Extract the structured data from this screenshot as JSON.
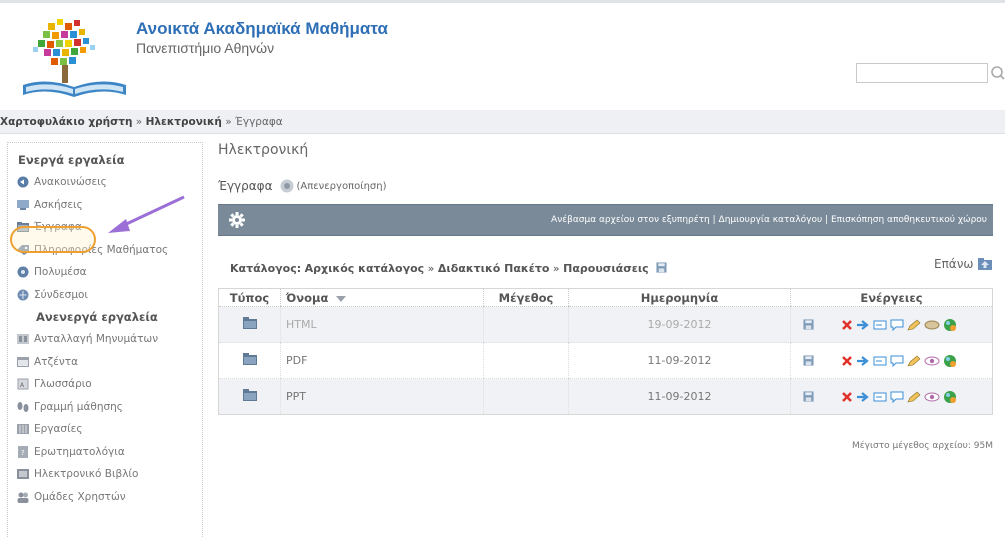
{
  "header": {
    "title": "Ανοικτά Ακαδημαϊκά Μαθήματα",
    "subtitle": "Πανεπιστήμιο Αθηνών",
    "search": {
      "value": "",
      "placeholder": ""
    }
  },
  "breadcrumb": {
    "portfolio": "Χαρτοφυλάκιο χρήστη",
    "sep1": " » ",
    "course": "Ηλεκτρονική",
    "sep2": " » ",
    "current": "Έγγραφα"
  },
  "sidebar": {
    "active_heading": "Ενεργά εργαλεία",
    "active_items": [
      {
        "label": "Ανακοινώσεις",
        "icon": "announcements-icon"
      },
      {
        "label": "Ασκήσεις",
        "icon": "exercises-icon"
      },
      {
        "label": "Έγγραφα",
        "icon": "documents-icon"
      },
      {
        "label": "Πληροφορίες Μαθήματος",
        "icon": "course-info-icon"
      },
      {
        "label": "Πολυμέσα",
        "icon": "multimedia-icon"
      },
      {
        "label": "Σύνδεσμοι",
        "icon": "links-icon"
      }
    ],
    "inactive_heading": "Ανενεργά εργαλεία",
    "inactive_items": [
      {
        "label": "Ανταλλαγή Μηνυμάτων",
        "icon": "messages-icon"
      },
      {
        "label": "Ατζέντα",
        "icon": "agenda-icon"
      },
      {
        "label": "Γλωσσάριο",
        "icon": "glossary-icon"
      },
      {
        "label": "Γραμμή μάθησης",
        "icon": "learning-path-icon"
      },
      {
        "label": "Εργασίες",
        "icon": "assignments-icon"
      },
      {
        "label": "Ερωτηματολόγια",
        "icon": "questionnaire-icon"
      },
      {
        "label": "Ηλεκτρονικό Βιβλίο",
        "icon": "ebook-icon"
      },
      {
        "label": "Ομάδες Χρηστών",
        "icon": "user-groups-icon"
      }
    ]
  },
  "main": {
    "course_title": "Ηλεκτρονική",
    "docs_label": "Έγγραφα",
    "deactivate_label": "(Απενεργοποίηση)",
    "toolbar": {
      "upload": "Ανέβασμα αρχείου στον εξυπηρέτη",
      "sep": " | ",
      "create_dir": "Δημιουργία καταλόγου",
      "storage": "Επισκόπηση αποθηκευτικού χώρου"
    },
    "catalog": {
      "label": "Κατάλογος:",
      "root": "Αρχικός κατάλογος",
      "sep": " » ",
      "level1": "Διδακτικό Πακέτο",
      "level2": "Παρουσιάσεις"
    },
    "up_label": "Επάνω",
    "table": {
      "headers": {
        "type": "Τύπος",
        "name": "Όνομα",
        "size": "Μέγεθος",
        "date": "Ημερομηνία",
        "actions": "Ενέργειες"
      },
      "rows": [
        {
          "name": "HTML",
          "size": "",
          "date": "19-09-2012",
          "visible": false
        },
        {
          "name": "PDF",
          "size": "",
          "date": "11-09-2012",
          "visible": true
        },
        {
          "name": "PPT",
          "size": "",
          "date": "11-09-2012",
          "visible": true
        }
      ]
    },
    "max_size": "Μέγιστο μέγεθος αρχείου: 95M"
  },
  "colors": {
    "title_blue": "#2f6fb6",
    "toolbar_bg": "#7a8a99",
    "highlight_orange": "#f0a030",
    "arrow_purple": "#9b6fd6"
  }
}
